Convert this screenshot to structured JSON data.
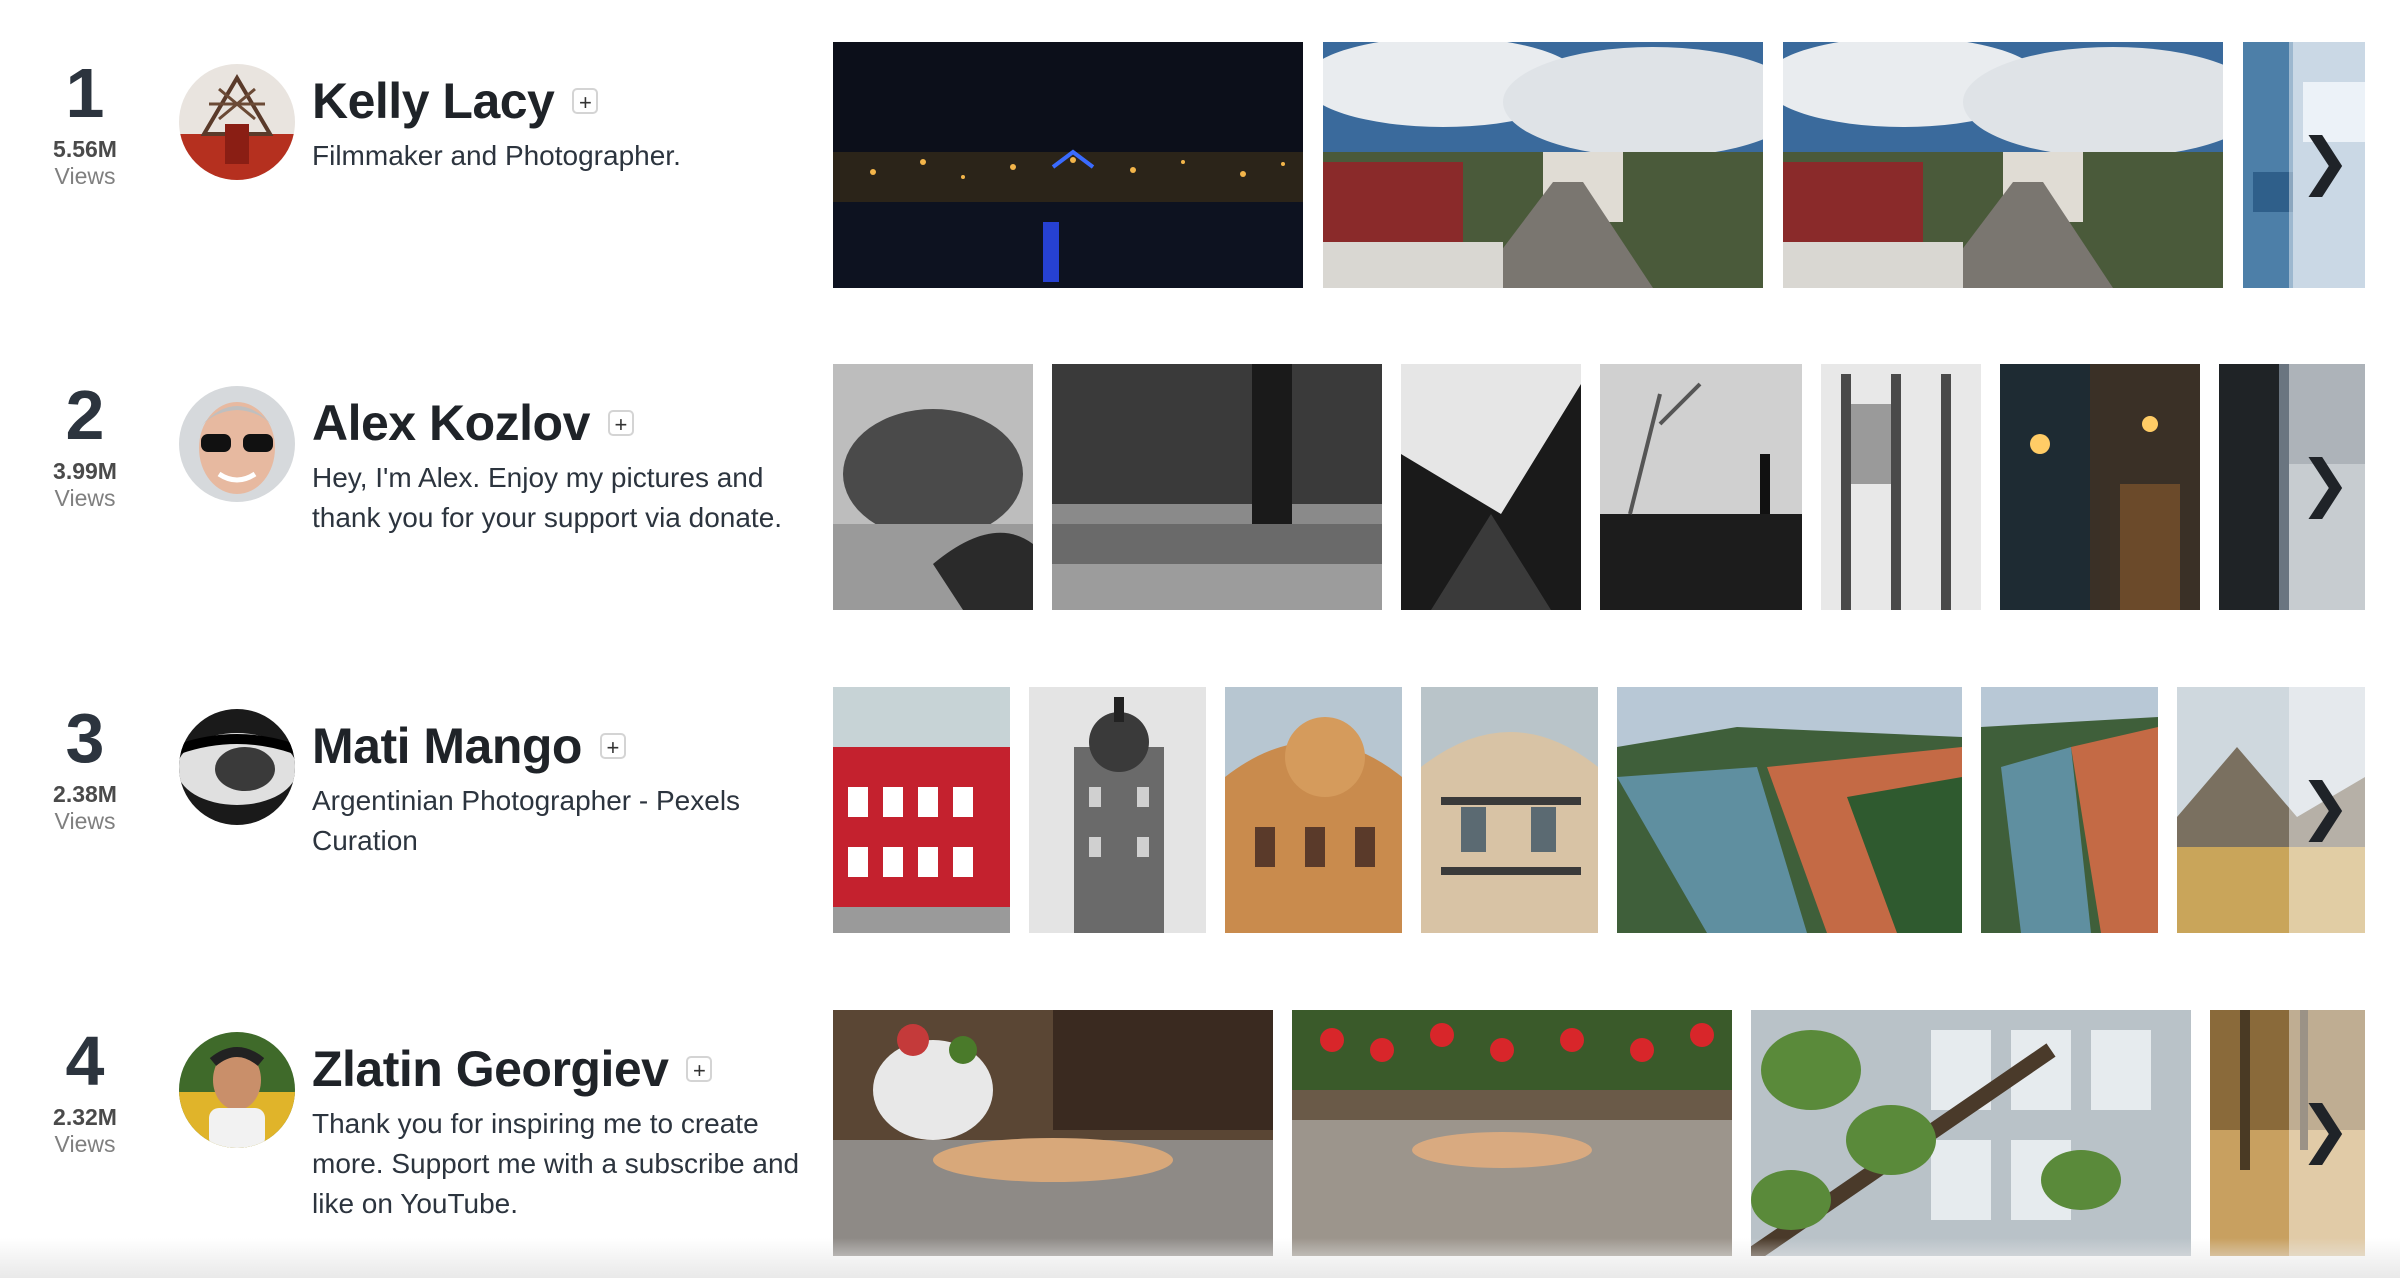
{
  "photographers": [
    {
      "rank": "1",
      "views": "5.56M",
      "views_label": "Views",
      "name": "Kelly Lacy",
      "follow": "+",
      "bio": "Filmmaker and Photographer."
    },
    {
      "rank": "2",
      "views": "3.99M",
      "views_label": "Views",
      "name": "Alex Kozlov",
      "follow": "+",
      "bio": "Hey, I'm Alex. Enjoy my pictures and thank you for your support via donate."
    },
    {
      "rank": "3",
      "views": "2.38M",
      "views_label": "Views",
      "name": "Mati Mango",
      "follow": "+",
      "bio": "Argentinian Photographer - Pexels Curation"
    },
    {
      "rank": "4",
      "views": "2.32M",
      "views_label": "Views",
      "name": "Zlatin Georgiev",
      "follow": "+",
      "bio": "Thank you for inspiring me to create more. Support me with a subscribe and like on YouTube."
    }
  ],
  "next_glyph": "❯"
}
